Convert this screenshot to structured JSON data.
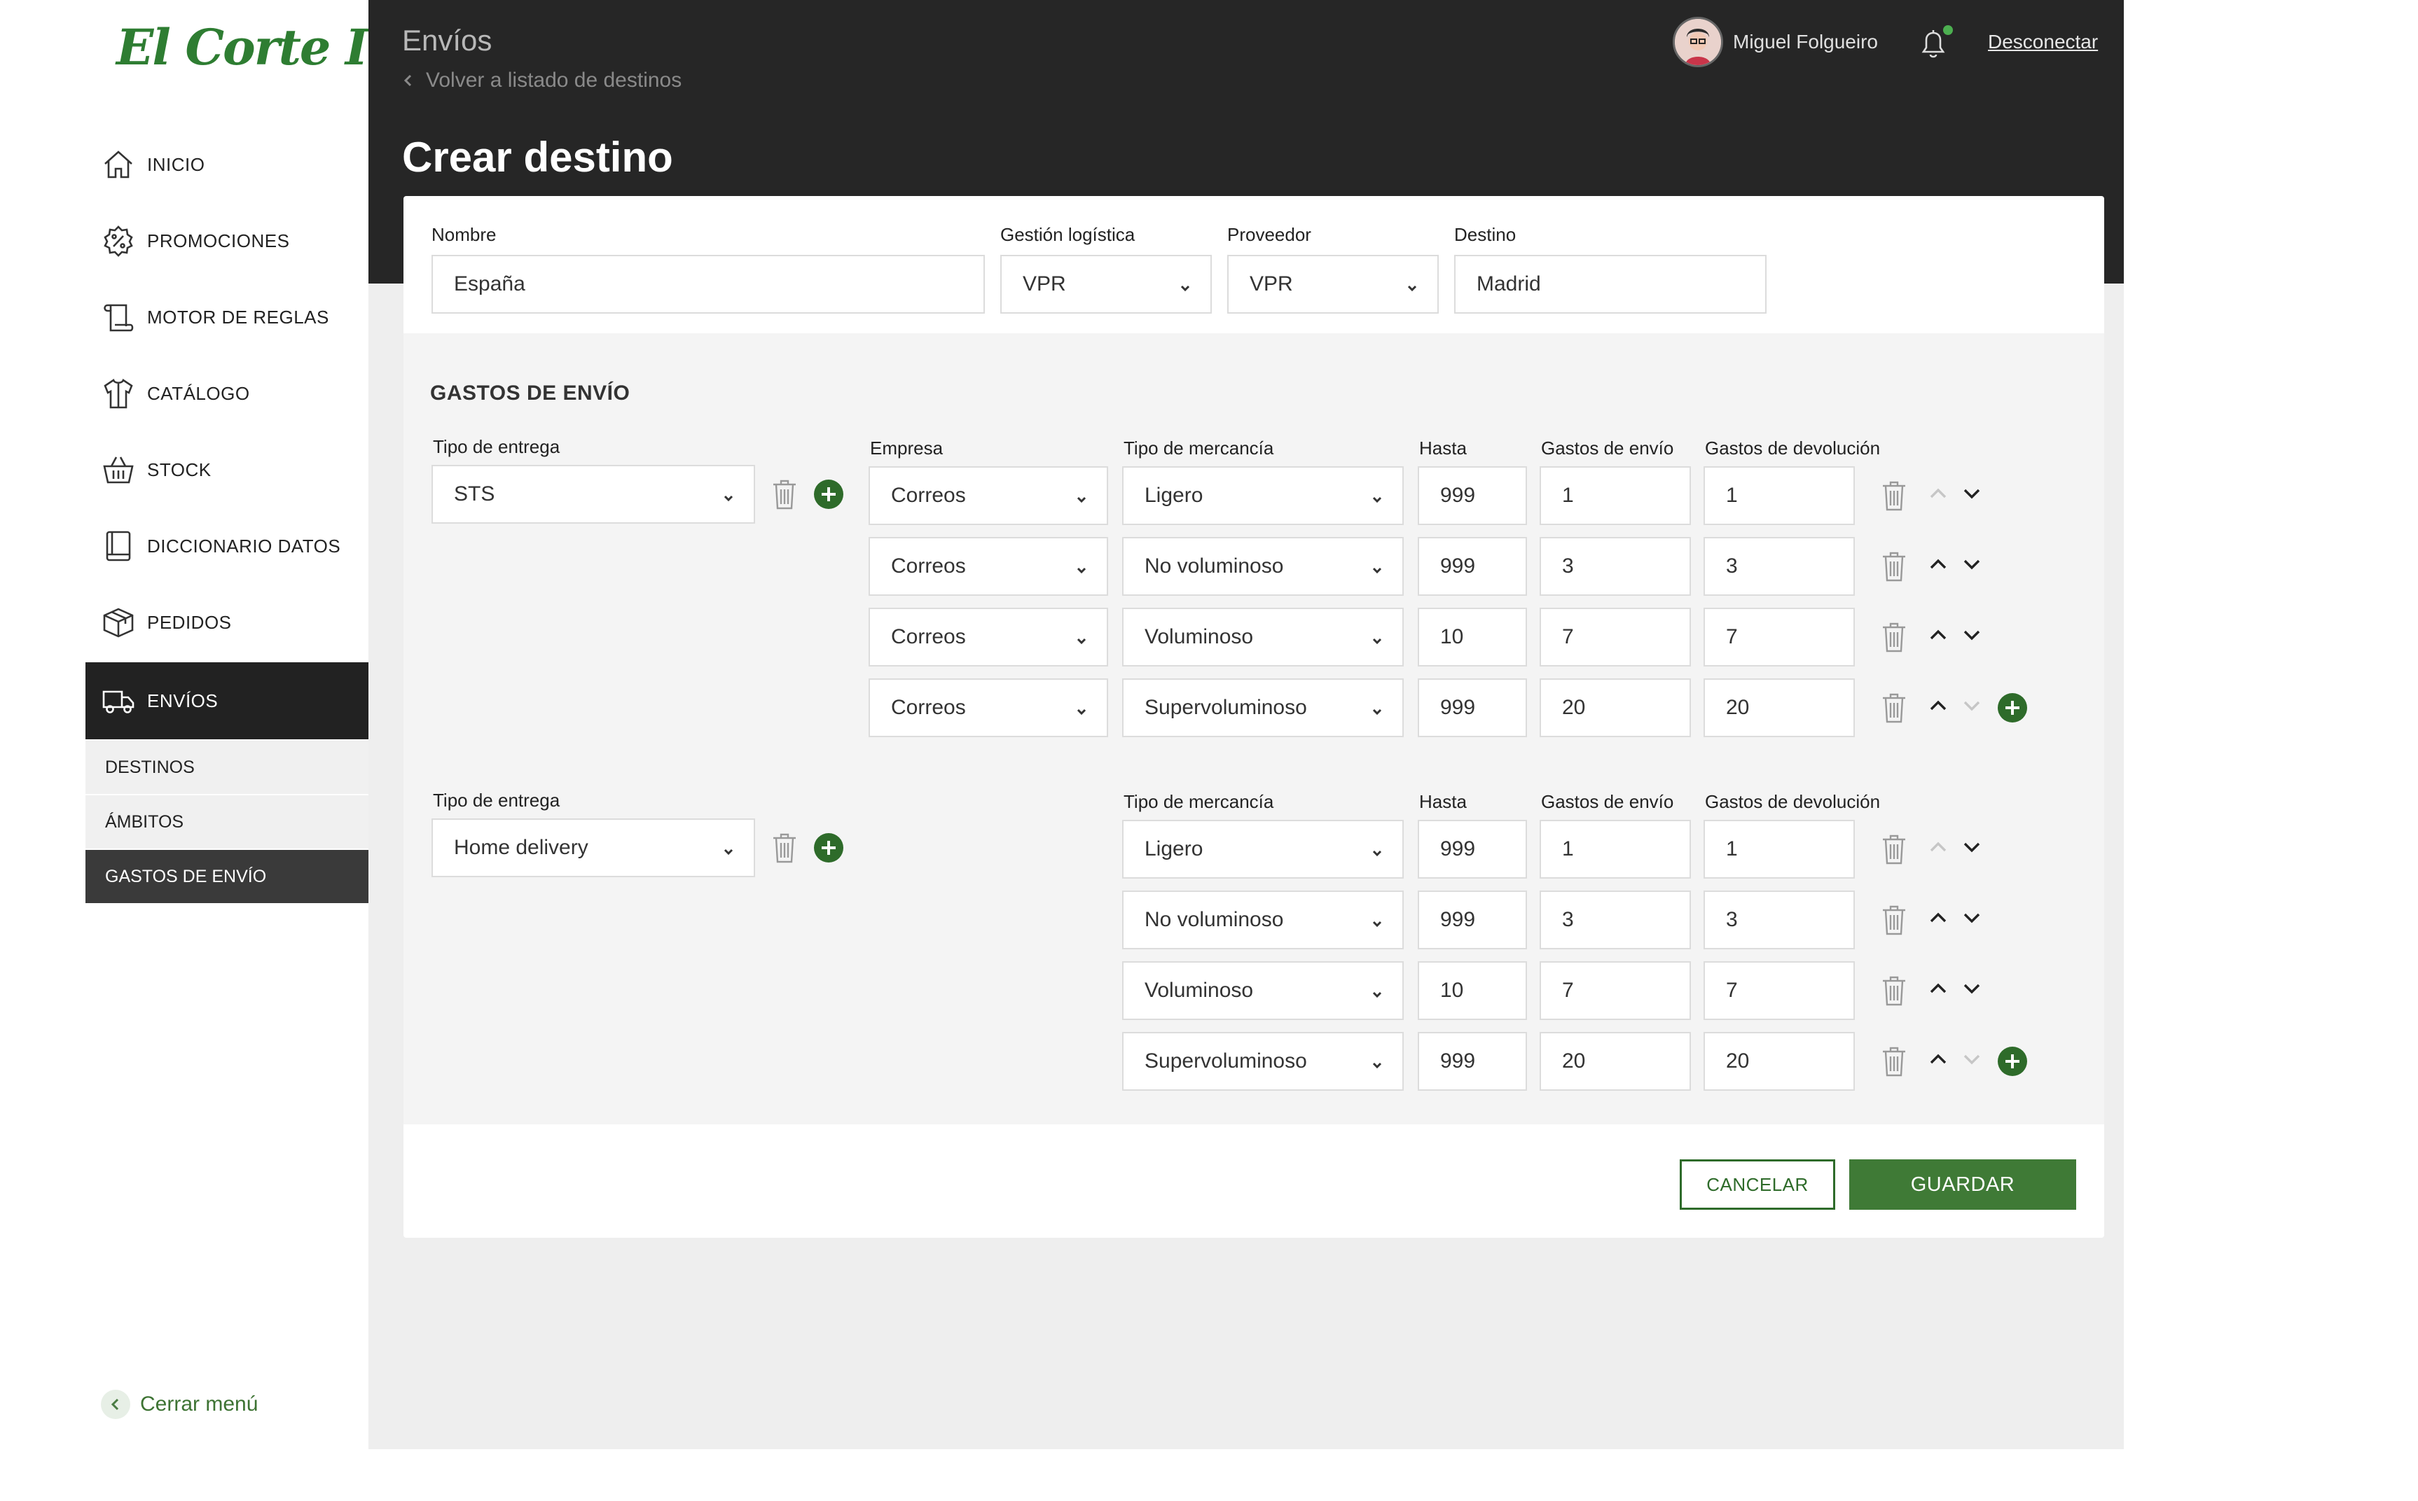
{
  "brand": {
    "logo_text": "El Corte Inglés",
    "accent": "#2e6b2a"
  },
  "sidebar": {
    "items": [
      {
        "label": "INICIO",
        "icon": "home-icon"
      },
      {
        "label": "PROMOCIONES",
        "icon": "promo-badge-icon"
      },
      {
        "label": "MOTOR DE REGLAS",
        "icon": "scroll-icon"
      },
      {
        "label": "CATÁLOGO",
        "icon": "shirt-icon"
      },
      {
        "label": "STOCK",
        "icon": "basket-icon"
      },
      {
        "label": "DICCIONARIO DATOS",
        "icon": "book-icon"
      },
      {
        "label": "PEDIDOS",
        "icon": "box-icon"
      },
      {
        "label": "ENVÍOS",
        "icon": "truck-icon",
        "active": true
      }
    ],
    "subitems": [
      {
        "label": "DESTINOS"
      },
      {
        "label": "ÁMBITOS"
      },
      {
        "label": "GASTOS DE ENVÍO",
        "active": true
      }
    ],
    "close_menu": "Cerrar menú"
  },
  "header": {
    "section": "Envíos",
    "back_link": "Volver a listado de destinos",
    "page_title": "Crear destino",
    "user_name": "Miguel Folgueiro",
    "logout": "Desconectar"
  },
  "form": {
    "nombre": {
      "label": "Nombre",
      "value": "España"
    },
    "gestion": {
      "label": "Gestión logística",
      "value": "VPR"
    },
    "proveedor": {
      "label": "Proveedor",
      "value": "VPR"
    },
    "destino": {
      "label": "Destino",
      "value": "Madrid"
    }
  },
  "gastos": {
    "title": "GASTOS DE ENVÍO",
    "labels": {
      "tipo_entrega": "Tipo de entrega",
      "empresa": "Empresa",
      "tipo_mercancia": "Tipo de mercancía",
      "hasta": "Hasta",
      "gastos_envio": "Gastos de envío",
      "gastos_devolucion": "Gastos de devolución"
    },
    "groups": [
      {
        "tipo_entrega": "STS",
        "rows": [
          {
            "empresa": "Correos",
            "mercancia": "Ligero",
            "hasta": "999",
            "envio": "1",
            "devolucion": "1"
          },
          {
            "empresa": "Correos",
            "mercancia": "No voluminoso",
            "hasta": "999",
            "envio": "3",
            "devolucion": "3"
          },
          {
            "empresa": "Correos",
            "mercancia": "Voluminoso",
            "hasta": "10",
            "envio": "7",
            "devolucion": "7"
          },
          {
            "empresa": "Correos",
            "mercancia": "Supervoluminoso",
            "hasta": "999",
            "envio": "20",
            "devolucion": "20"
          }
        ]
      },
      {
        "tipo_entrega": "Home delivery",
        "rows": [
          {
            "mercancia": "Ligero",
            "hasta": "999",
            "envio": "1",
            "devolucion": "1"
          },
          {
            "mercancia": "No voluminoso",
            "hasta": "999",
            "envio": "3",
            "devolucion": "3"
          },
          {
            "mercancia": "Voluminoso",
            "hasta": "10",
            "envio": "7",
            "devolucion": "7"
          },
          {
            "mercancia": "Supervoluminoso",
            "hasta": "999",
            "envio": "20",
            "devolucion": "20"
          }
        ]
      }
    ]
  },
  "actions": {
    "cancel": "CANCELAR",
    "save": "GUARDAR"
  }
}
